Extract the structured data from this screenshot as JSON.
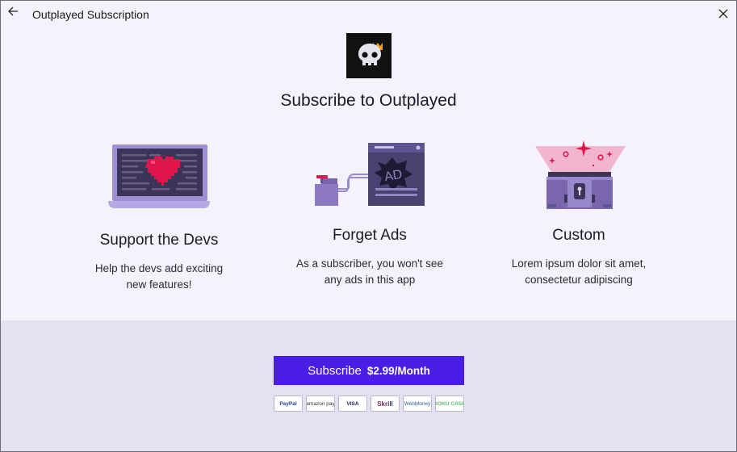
{
  "window": {
    "title": "Outplayed Subscription"
  },
  "headline": "Subscribe to  Outplayed",
  "features": [
    {
      "title": "Support the Devs",
      "desc_line1": "Help the devs add exciting",
      "desc_line2": "new features!"
    },
    {
      "title": "Forget Ads",
      "desc_line1": "As a subscriber, you won't see",
      "desc_line2": "any ads in this app"
    },
    {
      "title": "Custom",
      "desc_line1": "Lorem ipsum dolor sit amet,",
      "desc_line2": "consectetur adipiscing"
    }
  ],
  "ad_illustration_text": "AD",
  "subscribe": {
    "label": "Subscribe",
    "price": "$2.99/Month"
  },
  "payment_methods": [
    "PayPal",
    "amazon pay",
    "VISA",
    "Skrill",
    "WebMoney",
    "BOKU CASH"
  ],
  "colors": {
    "accent": "#4a1ee6",
    "bottom_panel": "#e4e1f0",
    "background": "#f4f3fc",
    "illustration_purple": "#7a66ad"
  }
}
